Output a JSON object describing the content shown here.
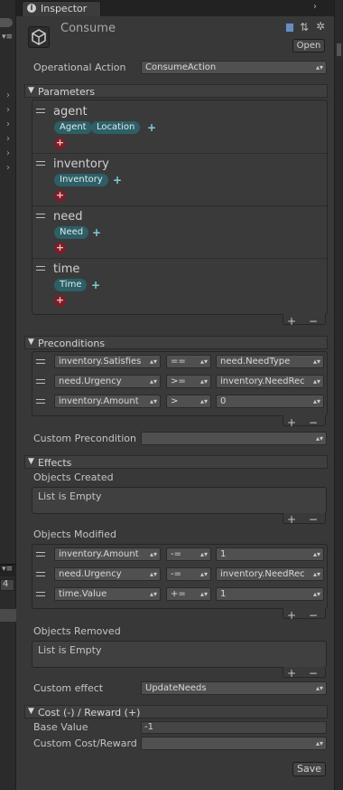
{
  "tab": {
    "title": "Inspector",
    "menu_glyph": "▾≡"
  },
  "header": {
    "object_name": "Consume",
    "open_label": "Open"
  },
  "operational_action": {
    "label": "Operational Action",
    "value": "ConsumeAction"
  },
  "parameters": {
    "title": "Parameters",
    "items": [
      {
        "name": "agent",
        "types": [
          "Agent",
          "Location"
        ]
      },
      {
        "name": "inventory",
        "types": [
          "Inventory"
        ]
      },
      {
        "name": "need",
        "types": [
          "Need"
        ]
      },
      {
        "name": "time",
        "types": [
          "Time"
        ]
      }
    ]
  },
  "preconditions": {
    "title": "Preconditions",
    "rows": [
      {
        "left": "inventory.Satisfies",
        "op": "==",
        "right": "need.NeedType"
      },
      {
        "left": "need.Urgency",
        "op": ">=",
        "right": "inventory.NeedRec"
      },
      {
        "left": "inventory.Amount",
        "op": ">",
        "right": "0"
      }
    ],
    "custom_label": "Custom Precondition",
    "custom_value": ""
  },
  "effects": {
    "title": "Effects",
    "created_label": "Objects Created",
    "created_empty": "List is Empty",
    "modified_label": "Objects Modified",
    "modified_rows": [
      {
        "left": "inventory.Amount",
        "op": "-=",
        "right": "1"
      },
      {
        "left": "need.Urgency",
        "op": "-=",
        "right": "inventory.NeedRec"
      },
      {
        "left": "time.Value",
        "op": "+=",
        "right": "1"
      }
    ],
    "removed_label": "Objects Removed",
    "removed_empty": "List is Empty",
    "custom_label": "Custom effect",
    "custom_value": "UpdateNeeds"
  },
  "cost": {
    "title": "Cost (-) / Reward (+)",
    "base_label": "Base Value",
    "base_value": "-1",
    "custom_label": "Custom Cost/Reward",
    "custom_value": ""
  },
  "save_label": "Save",
  "side": {
    "left_number": "4"
  },
  "glyphs": {
    "plus": "+",
    "minus": "−",
    "arrow": "▴▾",
    "tri": "▼",
    "chev": "›",
    "handle": "="
  }
}
